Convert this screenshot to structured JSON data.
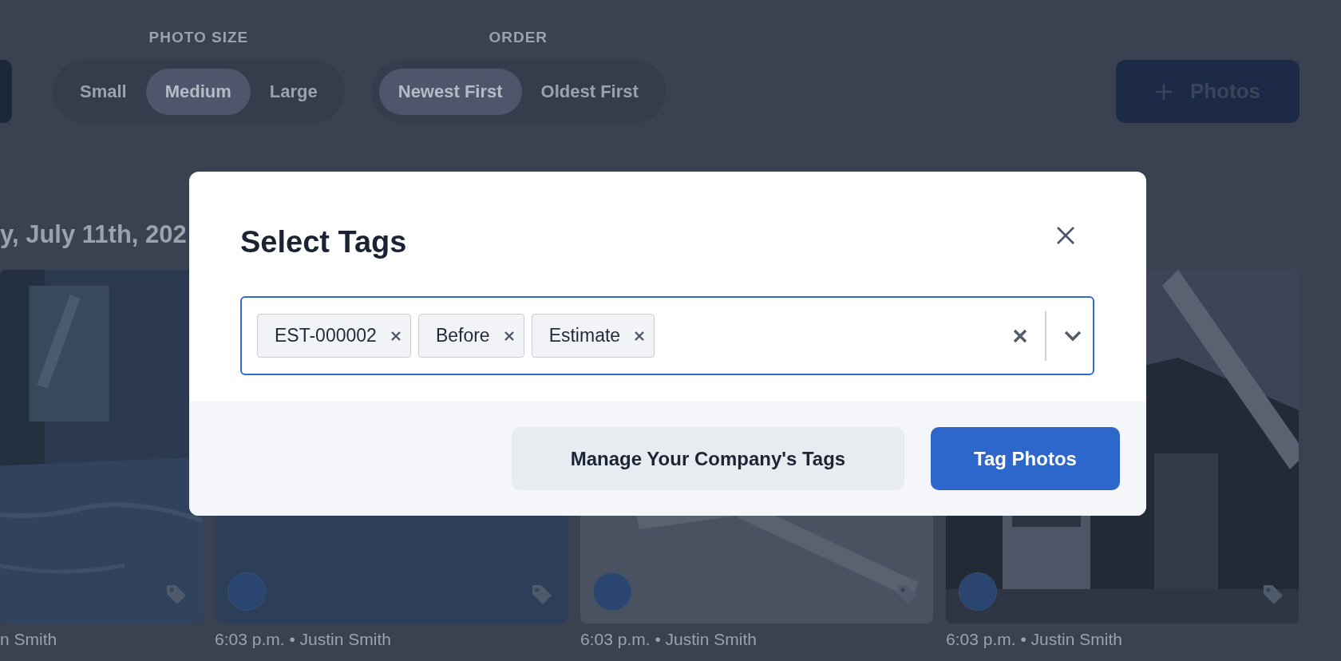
{
  "photo_size": {
    "label": "PHOTO SIZE",
    "options": [
      {
        "label": "Small",
        "selected": false
      },
      {
        "label": "Medium",
        "selected": true
      },
      {
        "label": "Large",
        "selected": false
      }
    ]
  },
  "order": {
    "label": "ORDER",
    "options": [
      {
        "label": "Newest First",
        "selected": true
      },
      {
        "label": "Oldest First",
        "selected": false
      }
    ]
  },
  "add_button": {
    "label": "Photos"
  },
  "date_heading": "y, July 11th, 202",
  "photos": [
    {
      "caption": "n Smith",
      "avatar": false
    },
    {
      "caption": "6:03 p.m. • Justin Smith",
      "avatar": true
    },
    {
      "caption": "6:03 p.m. • Justin Smith",
      "avatar": true
    },
    {
      "caption": "6:03 p.m. • Justin Smith",
      "avatar": true
    }
  ],
  "modal": {
    "title": "Select Tags",
    "tags": [
      "EST-000002",
      "Before",
      "Estimate"
    ],
    "buttons": [
      {
        "label": "Manage Your Company's Tags",
        "kind": "secondary"
      },
      {
        "label": "Tag Photos",
        "kind": "primary"
      }
    ]
  }
}
